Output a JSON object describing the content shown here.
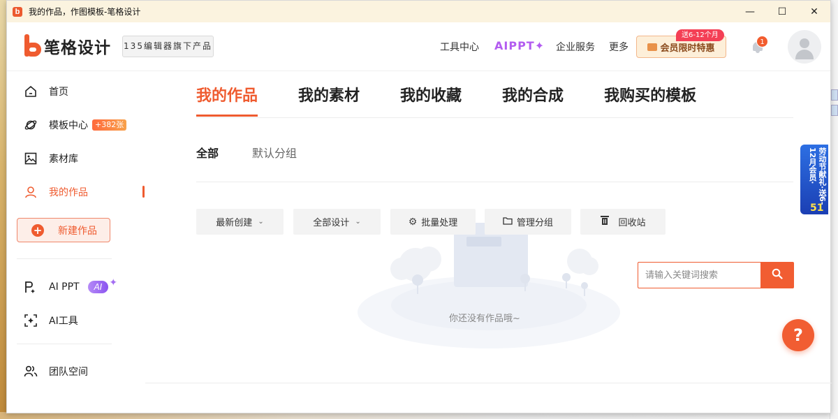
{
  "window": {
    "title": "我的作品，作图模板-笔格设计",
    "app_icon": "b"
  },
  "header": {
    "logo_text": "笔格设计",
    "sub_brand": "135编辑器旗下产品",
    "nav": [
      {
        "label": "工具中心"
      },
      {
        "label": "AIPPT✦"
      },
      {
        "label": "企业服务"
      },
      {
        "label": "更多"
      }
    ],
    "vip_button": "会员限时特惠",
    "vip_tag": "送6-12个月",
    "notification_count": "1"
  },
  "sidebar": {
    "items": [
      {
        "label": "首页",
        "icon": "home-icon"
      },
      {
        "label": "模板中心",
        "icon": "planet-icon",
        "badge": "+382张"
      },
      {
        "label": "素材库",
        "icon": "image-icon"
      },
      {
        "label": "我的作品",
        "icon": "user-icon",
        "active": true
      }
    ],
    "new_button": "新建作品",
    "ai_items": [
      {
        "label": "AI PPT",
        "icon": "ai-ppt-icon",
        "badge": "AI"
      },
      {
        "label": "AI工具",
        "icon": "ai-tool-icon"
      }
    ],
    "team": {
      "label": "团队空间",
      "icon": "team-icon"
    }
  },
  "main": {
    "tabs": [
      {
        "label": "我的作品",
        "active": true
      },
      {
        "label": "我的素材"
      },
      {
        "label": "我的收藏"
      },
      {
        "label": "我的合成"
      },
      {
        "label": "我购买的模板"
      }
    ],
    "subtabs": [
      {
        "label": "全部",
        "active": true
      },
      {
        "label": "默认分组"
      }
    ],
    "filters": {
      "sort": "最新创建",
      "design_type": "全部设计",
      "batch": "批量处理",
      "manage_groups": "管理分组",
      "recycle": "回收站"
    },
    "search": {
      "placeholder": "请输入关键词搜索"
    },
    "empty_text": "你还没有作品哦~"
  },
  "promo": {
    "text": "劳动节献礼·送6-12月会员·",
    "number": "51"
  },
  "help_button": "?",
  "colors": {
    "accent": "#ef5b2f",
    "ai_purple": "#b35cf0",
    "vip_red": "#f43f55"
  }
}
